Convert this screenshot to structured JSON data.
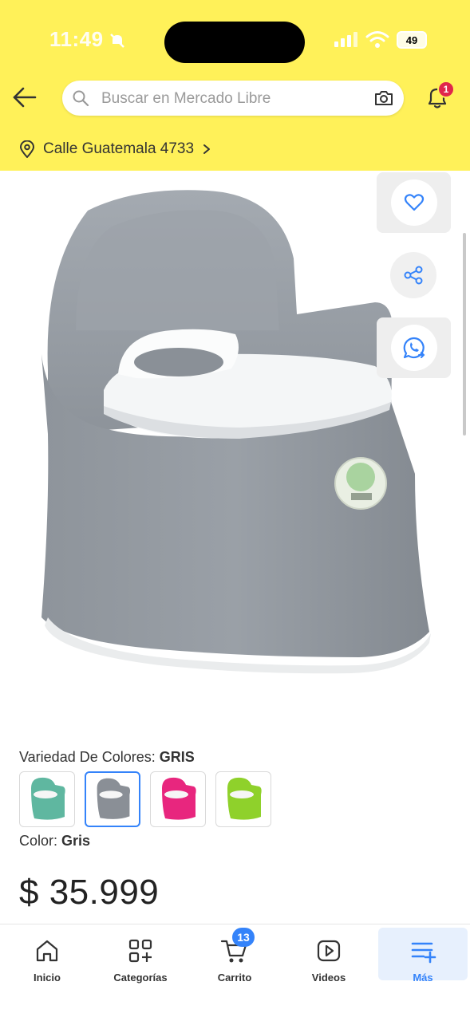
{
  "status_bar": {
    "time": "11:49",
    "battery": "49"
  },
  "header": {
    "search_placeholder": "Buscar en Mercado Libre",
    "notification_count": "1",
    "location": "Calle Guatemala 4733"
  },
  "colors": {
    "brand_yellow": "#fff159",
    "accent_blue": "#3483fa",
    "badge_red": "#e0264b"
  },
  "product": {
    "variant_label": "Variedad De Colores:",
    "variant_value": "GRIS",
    "variants": [
      {
        "name": "teal",
        "color": "#5fb7a0"
      },
      {
        "name": "gray",
        "color": "#8a8f96"
      },
      {
        "name": "pink",
        "color": "#e8267e"
      },
      {
        "name": "green",
        "color": "#8fd12b"
      }
    ],
    "color_label": "Color:",
    "color_value": "Gris",
    "price": "$ 35.999"
  },
  "bottom_nav": {
    "items": [
      {
        "label": "Inicio",
        "icon": "home-icon"
      },
      {
        "label": "Categorías",
        "icon": "categories-icon"
      },
      {
        "label": "Carrito",
        "icon": "cart-icon"
      },
      {
        "label": "Videos",
        "icon": "video-icon"
      },
      {
        "label": "Más",
        "icon": "menu-plus-icon"
      }
    ],
    "cart_count": "13"
  }
}
